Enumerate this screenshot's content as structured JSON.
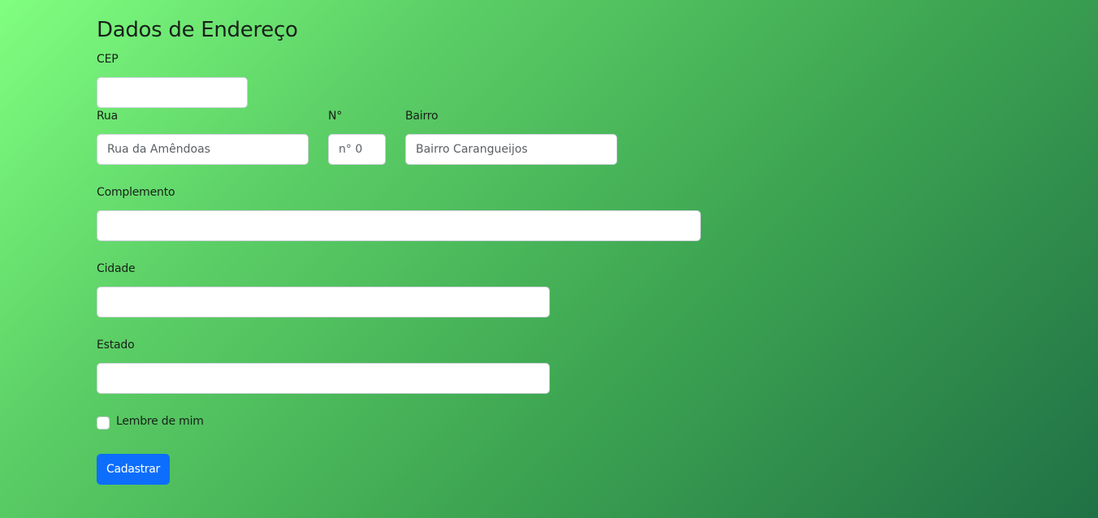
{
  "form": {
    "title": "Dados de Endereço",
    "cep": {
      "label": "CEP",
      "value": "",
      "placeholder": ""
    },
    "rua": {
      "label": "Rua",
      "value": "",
      "placeholder": "Rua da Amêndoas"
    },
    "numero": {
      "label": "N°",
      "value": "",
      "placeholder": "n° 0"
    },
    "bairro": {
      "label": "Bairro",
      "value": "",
      "placeholder": "Bairro Carangueijos"
    },
    "complemento": {
      "label": "Complemento",
      "value": "",
      "placeholder": ""
    },
    "cidade": {
      "label": "Cidade",
      "value": "",
      "placeholder": ""
    },
    "estado": {
      "label": "Estado",
      "value": "",
      "placeholder": ""
    },
    "remember": {
      "label": "Lembre de mim",
      "checked": false
    },
    "submit_label": "Cadastrar"
  },
  "colors": {
    "background_start": "#80ff80",
    "background_end": "#207145",
    "button": "#0d6efd"
  }
}
